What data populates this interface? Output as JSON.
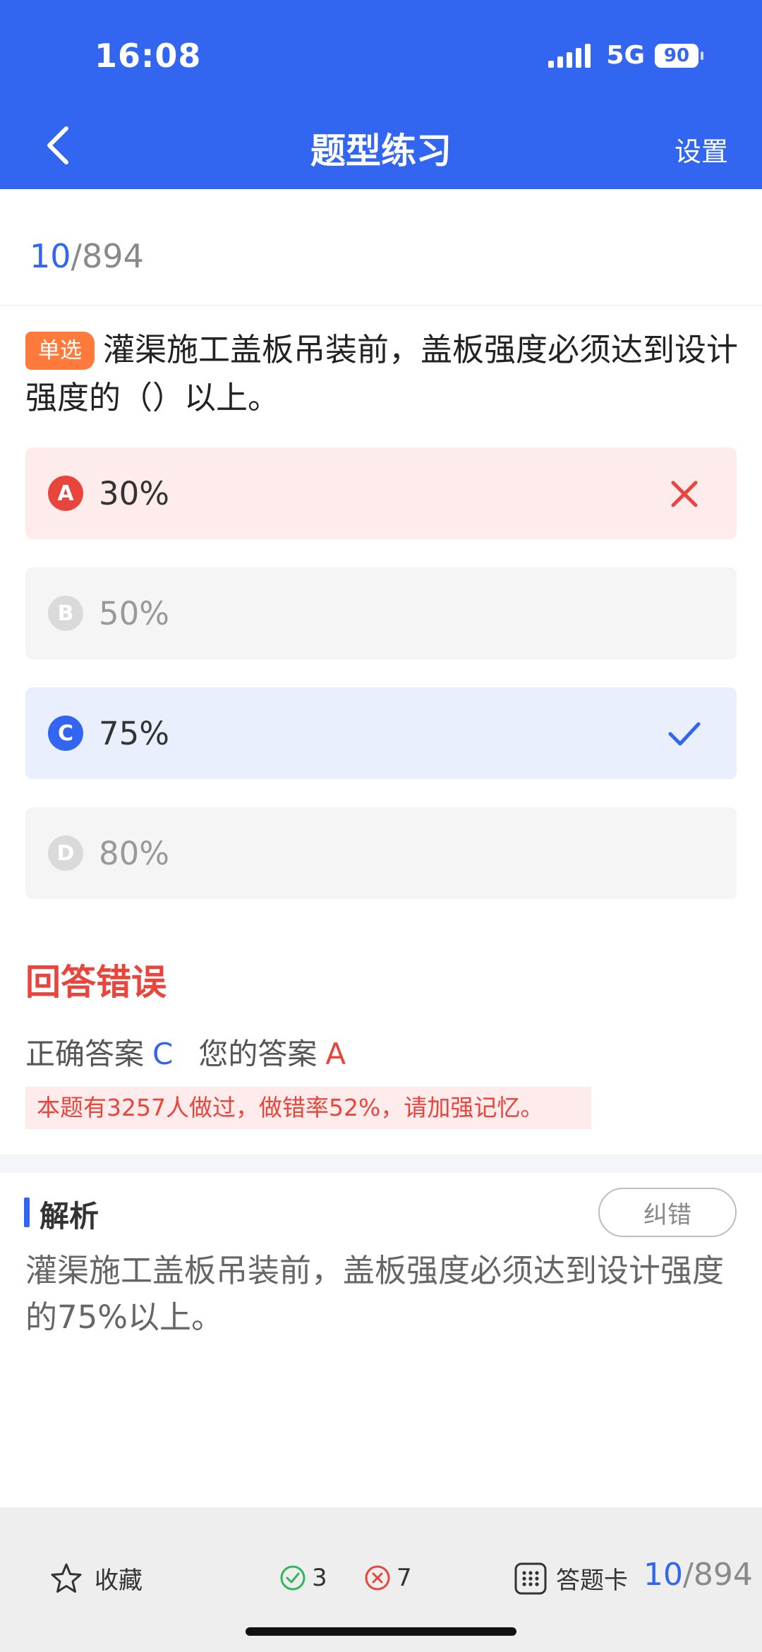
{
  "status": {
    "time": "16:08",
    "network": "5G",
    "battery": "90"
  },
  "nav": {
    "title": "题型练习",
    "settings": "设置",
    "back_icon": "chevron-left-icon"
  },
  "progress": {
    "current": "10",
    "total": "/894"
  },
  "question": {
    "type_tag": "单选",
    "text": "灌渠施工盖板吊装前，盖板强度必须达到设计强度的（）以上。"
  },
  "options": [
    {
      "letter": "A",
      "text": "30%",
      "state": "wrong"
    },
    {
      "letter": "B",
      "text": "50%",
      "state": "neutral"
    },
    {
      "letter": "C",
      "text": "75%",
      "state": "correct"
    },
    {
      "letter": "D",
      "text": "80%",
      "state": "neutral"
    }
  ],
  "result": {
    "title": "回答错误",
    "correct_label": "正确答案",
    "correct_value": "C",
    "your_label": "您的答案",
    "your_value": "A",
    "stat_text": "本题有3257人做过，做错率52%，请加强记忆。"
  },
  "analysis": {
    "title": "解析",
    "report_button": "纠错",
    "text": "灌渠施工盖板吊装前，盖板强度必须达到设计强度的75%以上。"
  },
  "bottom_bar": {
    "favorite_label": "收藏",
    "correct_count": "3",
    "wrong_count": "7",
    "card_label": "答题卡",
    "current": "10",
    "total": "/894"
  },
  "colors": {
    "primary": "#3366f0",
    "error": "#e8453c",
    "tag": "#ff7a3b",
    "success": "#2fb55a"
  }
}
